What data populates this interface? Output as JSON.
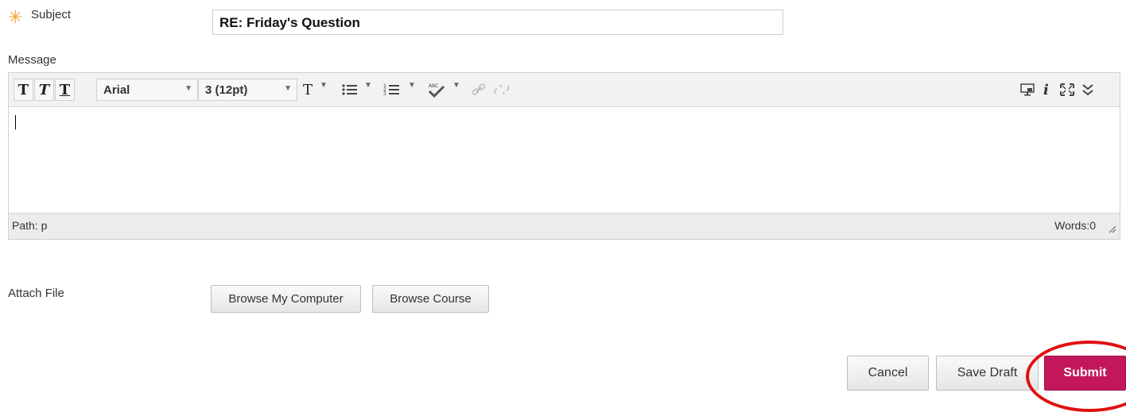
{
  "subject": {
    "label": "Subject",
    "required_mark": "✳",
    "value": "RE: Friday's Question"
  },
  "message": {
    "label": "Message",
    "toolbar": {
      "bold": "T",
      "italic": "T",
      "underline": "T",
      "font_family": "Arial",
      "font_size": "3 (12pt)",
      "text_color": "T"
    },
    "path_label": "Path: p",
    "word_count": "Words:0"
  },
  "attach": {
    "label": "Attach File",
    "browse_computer": "Browse My Computer",
    "browse_course": "Browse Course"
  },
  "actions": {
    "cancel": "Cancel",
    "save_draft": "Save Draft",
    "submit": "Submit"
  },
  "colors": {
    "accent_submit": "#c2185b",
    "required": "#f0a030",
    "highlight_ring": "#e01010"
  }
}
